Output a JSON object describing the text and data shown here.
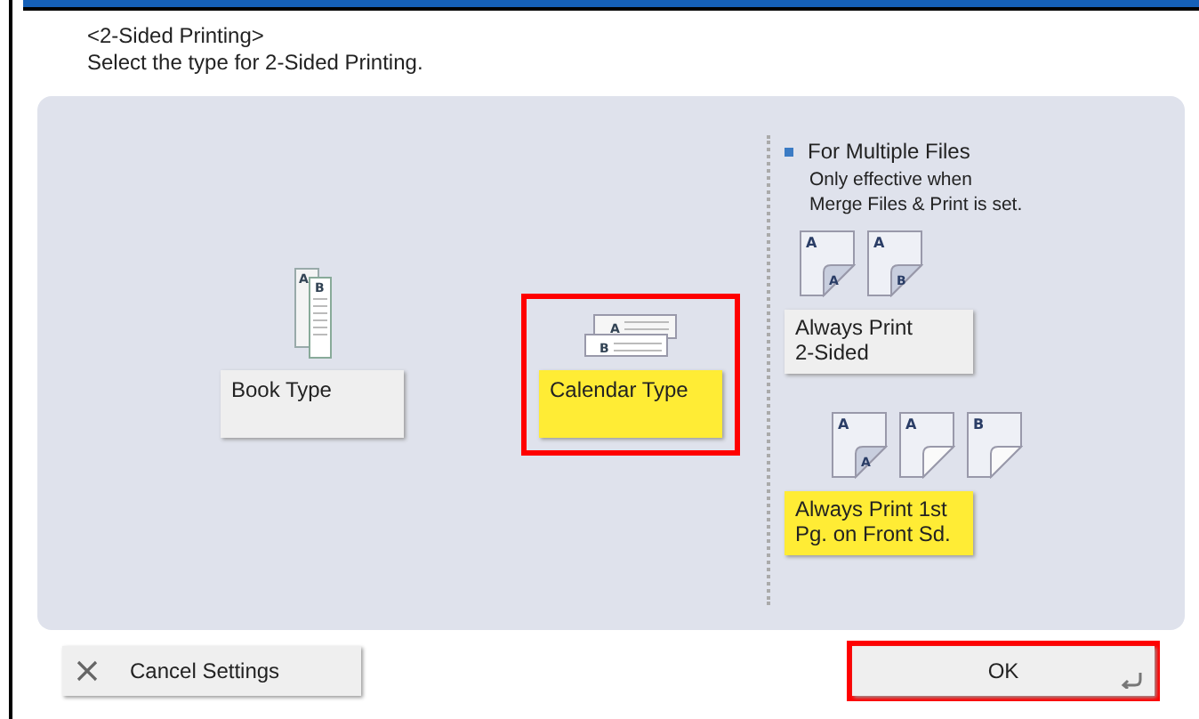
{
  "header": {
    "title": "<2-Sided Printing>",
    "instruction": "Select the type for 2-Sided Printing."
  },
  "types": [
    {
      "kind": "book",
      "label": "Book Type",
      "letters": [
        "A",
        "B"
      ],
      "selected": false,
      "highlighted": false
    },
    {
      "kind": "calendar",
      "label": "Calendar Type",
      "letters": [
        "A",
        "B"
      ],
      "selected": true,
      "highlighted": true
    }
  ],
  "multiple_files": {
    "heading": "For Multiple Files",
    "note": "Only effective when\nMerge Files & Print is set.",
    "options": [
      {
        "label": "Always Print\n2-Sided",
        "selected": false,
        "pages": [
          {
            "front": "A",
            "back": "A"
          },
          {
            "front": "A",
            "back": "B"
          }
        ]
      },
      {
        "label": "Always Print 1st\nPg. on Front Sd.",
        "selected": true,
        "pages": [
          {
            "front": "A",
            "back": "A"
          },
          {
            "front": "A"
          },
          {
            "front": "B"
          }
        ]
      }
    ]
  },
  "footer": {
    "cancel": {
      "label": "Cancel Settings"
    },
    "ok": {
      "label": "OK",
      "highlighted": true
    }
  }
}
